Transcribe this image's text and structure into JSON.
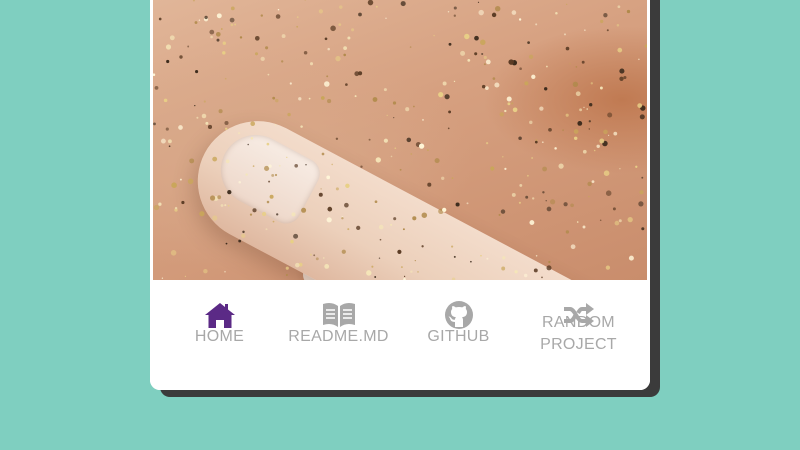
{
  "nav": {
    "items": [
      {
        "label": "HOME",
        "icon": "home-icon",
        "active": true
      },
      {
        "label": "README.MD",
        "icon": "book-open-icon",
        "active": false
      },
      {
        "label": "GITHUB",
        "icon": "github-icon",
        "active": false
      },
      {
        "label": "RANDOM",
        "label2": "PROJECT",
        "icon": "shuffle-icon",
        "active": false
      }
    ]
  },
  "colors": {
    "background": "#7fcfc0",
    "active_icon": "#5b2a86",
    "inactive": "#a8a8a8",
    "card_shadow": "#3b3b3b"
  }
}
